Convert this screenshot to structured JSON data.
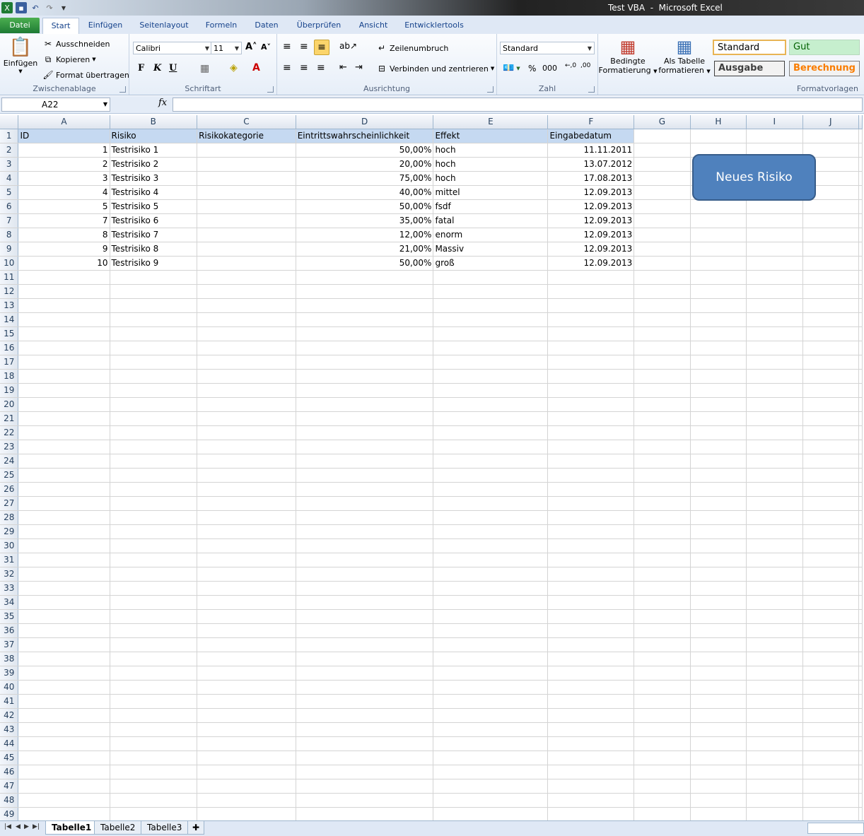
{
  "window": {
    "title": "Test VBA  -  Microsoft Excel"
  },
  "ribbon_tabs": [
    "Datei",
    "Start",
    "Einfügen",
    "Seitenlayout",
    "Formeln",
    "Daten",
    "Überprüfen",
    "Ansicht",
    "Entwicklertools"
  ],
  "clipboard": {
    "paste": "Einfügen",
    "cut": "Ausschneiden",
    "copy": "Kopieren",
    "format_painter": "Format übertragen",
    "label": "Zwischenablage"
  },
  "font": {
    "name": "Calibri",
    "size": "11",
    "bold": "F",
    "italic": "K",
    "underline": "U",
    "label": "Schriftart"
  },
  "alignment": {
    "wrap": "Zeilenumbruch",
    "merge": "Verbinden und zentrieren",
    "label": "Ausrichtung"
  },
  "number": {
    "format": "Standard",
    "percent": "%",
    "thousands": "000",
    "label": "Zahl"
  },
  "styles": {
    "conditional": "Bedingte",
    "conditional2": "Formatierung",
    "as_table": "Als Tabelle",
    "as_table2": "formatieren",
    "standard": "Standard",
    "good": "Gut",
    "output": "Ausgabe",
    "calc": "Berechnung",
    "label": "Formatvorlagen"
  },
  "formula_bar": {
    "name_box": "A22",
    "fx": "fx",
    "value": ""
  },
  "columns": [
    "A",
    "B",
    "C",
    "D",
    "E",
    "F",
    "G",
    "H",
    "I",
    "J"
  ],
  "header_row": [
    "ID",
    "Risiko",
    "Risikokategorie",
    "Eintrittswahrscheinlichkeit",
    "Effekt",
    "Eingabedatum"
  ],
  "rows": [
    [
      "1",
      "Testrisiko 1",
      "",
      "50,00%",
      "hoch",
      "11.11.2011"
    ],
    [
      "2",
      "Testrisiko 2",
      "",
      "20,00%",
      "hoch",
      "13.07.2012"
    ],
    [
      "3",
      "Testrisiko 3",
      "",
      "75,00%",
      "hoch",
      "17.08.2013"
    ],
    [
      "4",
      "Testrisiko 4",
      "",
      "40,00%",
      "mittel",
      "12.09.2013"
    ],
    [
      "5",
      "Testrisiko 5",
      "",
      "50,00%",
      "fsdf",
      "12.09.2013"
    ],
    [
      "7",
      "Testrisiko 6",
      "",
      "35,00%",
      "fatal",
      "12.09.2013"
    ],
    [
      "8",
      "Testrisiko 7",
      "",
      "12,00%",
      "enorm",
      "12.09.2013"
    ],
    [
      "9",
      "Testrisiko 8",
      "",
      "21,00%",
      "Massiv",
      "12.09.2013"
    ],
    [
      "10",
      "Testrisiko 9",
      "",
      "50,00%",
      "groß",
      "12.09.2013"
    ]
  ],
  "shape_button": "Neues Risiko",
  "sheets": [
    "Tabelle1",
    "Tabelle2",
    "Tabelle3"
  ],
  "colors": {
    "header_fill": "#c5d9f1",
    "button_fill": "#4f81bd",
    "datei_tab": "#1e7b34"
  }
}
